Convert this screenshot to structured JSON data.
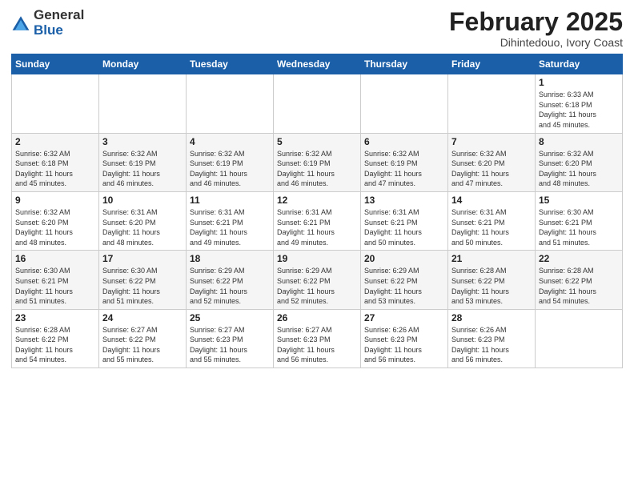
{
  "header": {
    "logo_general": "General",
    "logo_blue": "Blue",
    "month_year": "February 2025",
    "location": "Dihintedouo, Ivory Coast"
  },
  "days_of_week": [
    "Sunday",
    "Monday",
    "Tuesday",
    "Wednesday",
    "Thursday",
    "Friday",
    "Saturday"
  ],
  "weeks": [
    [
      {
        "day": "",
        "info": ""
      },
      {
        "day": "",
        "info": ""
      },
      {
        "day": "",
        "info": ""
      },
      {
        "day": "",
        "info": ""
      },
      {
        "day": "",
        "info": ""
      },
      {
        "day": "",
        "info": ""
      },
      {
        "day": "1",
        "info": "Sunrise: 6:33 AM\nSunset: 6:18 PM\nDaylight: 11 hours\nand 45 minutes."
      }
    ],
    [
      {
        "day": "2",
        "info": "Sunrise: 6:32 AM\nSunset: 6:18 PM\nDaylight: 11 hours\nand 45 minutes."
      },
      {
        "day": "3",
        "info": "Sunrise: 6:32 AM\nSunset: 6:19 PM\nDaylight: 11 hours\nand 46 minutes."
      },
      {
        "day": "4",
        "info": "Sunrise: 6:32 AM\nSunset: 6:19 PM\nDaylight: 11 hours\nand 46 minutes."
      },
      {
        "day": "5",
        "info": "Sunrise: 6:32 AM\nSunset: 6:19 PM\nDaylight: 11 hours\nand 46 minutes."
      },
      {
        "day": "6",
        "info": "Sunrise: 6:32 AM\nSunset: 6:19 PM\nDaylight: 11 hours\nand 47 minutes."
      },
      {
        "day": "7",
        "info": "Sunrise: 6:32 AM\nSunset: 6:20 PM\nDaylight: 11 hours\nand 47 minutes."
      },
      {
        "day": "8",
        "info": "Sunrise: 6:32 AM\nSunset: 6:20 PM\nDaylight: 11 hours\nand 48 minutes."
      }
    ],
    [
      {
        "day": "9",
        "info": "Sunrise: 6:32 AM\nSunset: 6:20 PM\nDaylight: 11 hours\nand 48 minutes."
      },
      {
        "day": "10",
        "info": "Sunrise: 6:31 AM\nSunset: 6:20 PM\nDaylight: 11 hours\nand 48 minutes."
      },
      {
        "day": "11",
        "info": "Sunrise: 6:31 AM\nSunset: 6:21 PM\nDaylight: 11 hours\nand 49 minutes."
      },
      {
        "day": "12",
        "info": "Sunrise: 6:31 AM\nSunset: 6:21 PM\nDaylight: 11 hours\nand 49 minutes."
      },
      {
        "day": "13",
        "info": "Sunrise: 6:31 AM\nSunset: 6:21 PM\nDaylight: 11 hours\nand 50 minutes."
      },
      {
        "day": "14",
        "info": "Sunrise: 6:31 AM\nSunset: 6:21 PM\nDaylight: 11 hours\nand 50 minutes."
      },
      {
        "day": "15",
        "info": "Sunrise: 6:30 AM\nSunset: 6:21 PM\nDaylight: 11 hours\nand 51 minutes."
      }
    ],
    [
      {
        "day": "16",
        "info": "Sunrise: 6:30 AM\nSunset: 6:21 PM\nDaylight: 11 hours\nand 51 minutes."
      },
      {
        "day": "17",
        "info": "Sunrise: 6:30 AM\nSunset: 6:22 PM\nDaylight: 11 hours\nand 51 minutes."
      },
      {
        "day": "18",
        "info": "Sunrise: 6:29 AM\nSunset: 6:22 PM\nDaylight: 11 hours\nand 52 minutes."
      },
      {
        "day": "19",
        "info": "Sunrise: 6:29 AM\nSunset: 6:22 PM\nDaylight: 11 hours\nand 52 minutes."
      },
      {
        "day": "20",
        "info": "Sunrise: 6:29 AM\nSunset: 6:22 PM\nDaylight: 11 hours\nand 53 minutes."
      },
      {
        "day": "21",
        "info": "Sunrise: 6:28 AM\nSunset: 6:22 PM\nDaylight: 11 hours\nand 53 minutes."
      },
      {
        "day": "22",
        "info": "Sunrise: 6:28 AM\nSunset: 6:22 PM\nDaylight: 11 hours\nand 54 minutes."
      }
    ],
    [
      {
        "day": "23",
        "info": "Sunrise: 6:28 AM\nSunset: 6:22 PM\nDaylight: 11 hours\nand 54 minutes."
      },
      {
        "day": "24",
        "info": "Sunrise: 6:27 AM\nSunset: 6:22 PM\nDaylight: 11 hours\nand 55 minutes."
      },
      {
        "day": "25",
        "info": "Sunrise: 6:27 AM\nSunset: 6:23 PM\nDaylight: 11 hours\nand 55 minutes."
      },
      {
        "day": "26",
        "info": "Sunrise: 6:27 AM\nSunset: 6:23 PM\nDaylight: 11 hours\nand 56 minutes."
      },
      {
        "day": "27",
        "info": "Sunrise: 6:26 AM\nSunset: 6:23 PM\nDaylight: 11 hours\nand 56 minutes."
      },
      {
        "day": "28",
        "info": "Sunrise: 6:26 AM\nSunset: 6:23 PM\nDaylight: 11 hours\nand 56 minutes."
      },
      {
        "day": "",
        "info": ""
      }
    ]
  ]
}
